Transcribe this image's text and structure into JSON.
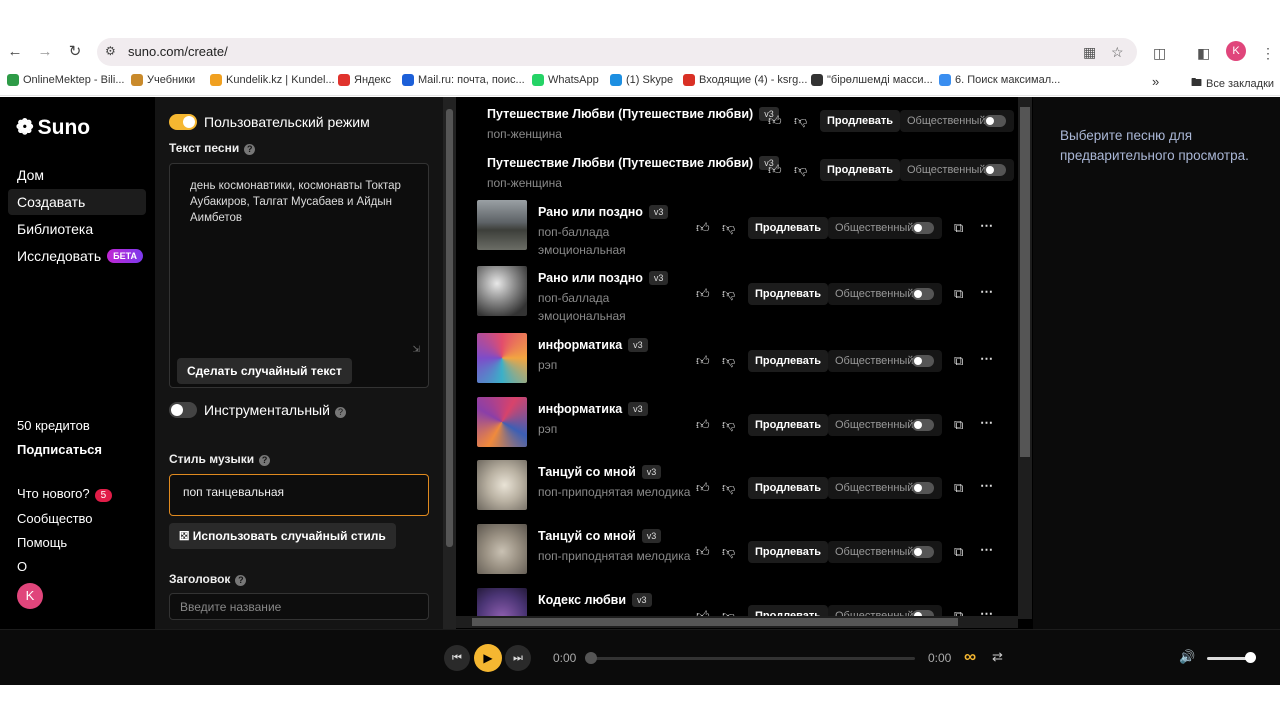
{
  "browser": {
    "url": "suno.com/create/",
    "profile_initial": "K",
    "bookmarks": [
      {
        "label": "OnlineMektep - Bili...",
        "color": "#2e9b47"
      },
      {
        "label": "Учебники",
        "color": "#c98a2b"
      },
      {
        "label": "Kundelik.kz | Kundel...",
        "color": "#f0a020"
      },
      {
        "label": "Яндекс",
        "color": "#e0332d"
      },
      {
        "label": "Mail.ru: почта, поис...",
        "color": "#1c5fd8"
      },
      {
        "label": "WhatsApp",
        "color": "#25d366"
      },
      {
        "label": "(1) Skype",
        "color": "#1d8fe1"
      },
      {
        "label": "Входящие (4) - ksrg...",
        "color": "#d93025"
      },
      {
        "label": "\"бірөлшемді масси...",
        "color": "#333333"
      },
      {
        "label": "6. Поиск максимал...",
        "color": "#3a8ef0"
      }
    ],
    "all_bookmarks": "Все закладки",
    "more_bookmarks": "»"
  },
  "sidebar": {
    "logo": "Suno",
    "nav": [
      {
        "label": "Дом"
      },
      {
        "label": "Создавать"
      },
      {
        "label": "Библиотека"
      },
      {
        "label": "Исследовать",
        "badge": "БЕТА"
      }
    ],
    "credits": "50 кредитов",
    "subscribe": "Подписаться",
    "whats_new": "Что нового?",
    "whats_new_count": "5",
    "community": "Сообщество",
    "help": "Помощь",
    "about": "О",
    "user_initial": "K"
  },
  "create": {
    "custom_mode": "Пользовательский режим",
    "lyrics_label": "Текст песни",
    "lyrics_text": "день космонавтики, космонавты Токтар Аубакиров, Талгат Мусабаев и Айдын Аимбетов",
    "random_lyrics": "Сделать случайный текст",
    "instrumental": "Инструментальный",
    "style_label": "Стиль музыки",
    "style_value": "поп танцевальная",
    "random_style": "Использовать случайный стиль",
    "title_label": "Заголовок",
    "title_placeholder": "Введите название"
  },
  "songs": [
    {
      "title": "Путешествие Любви (Путешествие любви)",
      "version": "v3",
      "genre": "поп-женщина",
      "genre2": "",
      "thumb": ""
    },
    {
      "title": "Путешествие Любви (Путешествие любви)",
      "version": "v3",
      "genre": "поп-женщина",
      "genre2": "",
      "thumb": ""
    },
    {
      "title": "Рано или поздно",
      "version": "v3",
      "genre": "поп-баллада",
      "genre2": "эмоциональная",
      "thumb": "road"
    },
    {
      "title": "Рано или поздно",
      "version": "v3",
      "genre": "поп-баллада",
      "genre2": "эмоциональная",
      "thumb": "clouds"
    },
    {
      "title": "информатика",
      "version": "v3",
      "genre": "рэп",
      "genre2": "",
      "thumb": "hex1"
    },
    {
      "title": "информатика",
      "version": "v3",
      "genre": "рэп",
      "genre2": "",
      "thumb": "hex2"
    },
    {
      "title": "Танцуй со мной",
      "version": "v3",
      "genre": "поп-приподнятая мелодика",
      "genre2": "",
      "thumb": "bird1"
    },
    {
      "title": "Танцуй со мной",
      "version": "v3",
      "genre": "поп-приподнятая мелодика",
      "genre2": "",
      "thumb": "bird2"
    },
    {
      "title": "Кодекс любви",
      "version": "v3",
      "genre": "",
      "genre2": "",
      "thumb": "heart"
    }
  ],
  "song_actions": {
    "extend": "Продлевать",
    "public": "Общественный"
  },
  "preview": {
    "text": "Выберите песню для предварительного просмотра."
  },
  "player": {
    "time_current": "0:00",
    "time_total": "0:00",
    "progress": 0,
    "volume": 0.85
  }
}
